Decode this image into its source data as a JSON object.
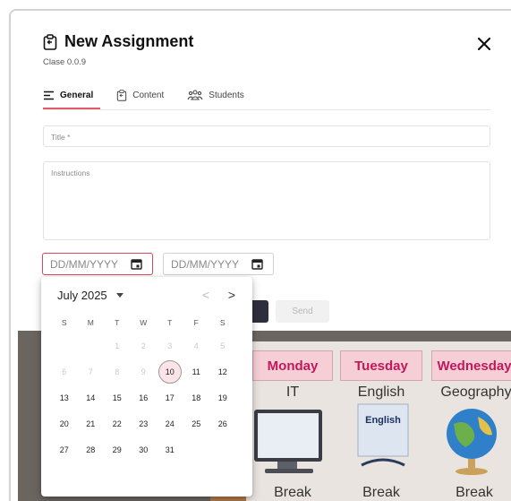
{
  "dialog": {
    "title": "New Assignment",
    "subtitle": "Clase 0.0.9"
  },
  "tabs": [
    {
      "label": "General",
      "icon": "lines-icon",
      "active": true
    },
    {
      "label": "Content",
      "icon": "clipboard-icon",
      "active": false
    },
    {
      "label": "Students",
      "icon": "group-icon",
      "active": false
    }
  ],
  "form": {
    "title_placeholder": "Title *",
    "instructions_placeholder": "Instructions",
    "start_date_placeholder": "DD/MM/YYYY",
    "end_date_placeholder": "DD/MM/YYYY",
    "send_label": "Send"
  },
  "picker": {
    "month_label": "July 2025",
    "prev": "<",
    "next": ">",
    "weekdays": [
      "S",
      "M",
      "T",
      "W",
      "T",
      "F",
      "S"
    ],
    "weeks": [
      [
        {
          "d": ""
        },
        {
          "d": ""
        },
        {
          "d": "1",
          "dis": true
        },
        {
          "d": "2",
          "dis": true
        },
        {
          "d": "3",
          "dis": true
        },
        {
          "d": "4",
          "dis": true
        },
        {
          "d": "5",
          "dis": true
        }
      ],
      [
        {
          "d": "6",
          "dis": true
        },
        {
          "d": "7",
          "dis": true
        },
        {
          "d": "8",
          "dis": true
        },
        {
          "d": "9",
          "dis": true
        },
        {
          "d": "10",
          "sel": true
        },
        {
          "d": "11"
        },
        {
          "d": "12"
        }
      ],
      [
        {
          "d": "13"
        },
        {
          "d": "14"
        },
        {
          "d": "15"
        },
        {
          "d": "16"
        },
        {
          "d": "17"
        },
        {
          "d": "18"
        },
        {
          "d": "19"
        }
      ],
      [
        {
          "d": "20"
        },
        {
          "d": "21"
        },
        {
          "d": "22"
        },
        {
          "d": "23"
        },
        {
          "d": "24"
        },
        {
          "d": "25"
        },
        {
          "d": "26"
        }
      ],
      [
        {
          "d": "27"
        },
        {
          "d": "28"
        },
        {
          "d": "29"
        },
        {
          "d": "30"
        },
        {
          "d": "31"
        },
        {
          "d": ""
        },
        {
          "d": ""
        }
      ]
    ]
  },
  "timetable": {
    "days": [
      "Monday",
      "Tuesday",
      "Wednesday"
    ],
    "subjects": [
      "IT",
      "English",
      "Geography"
    ],
    "book_label": "English",
    "break_label": "Break"
  },
  "colors": {
    "accent": "#e05a6e",
    "dark_button": "#2d2f3d",
    "selected_day_bg": "#fde4e8"
  }
}
